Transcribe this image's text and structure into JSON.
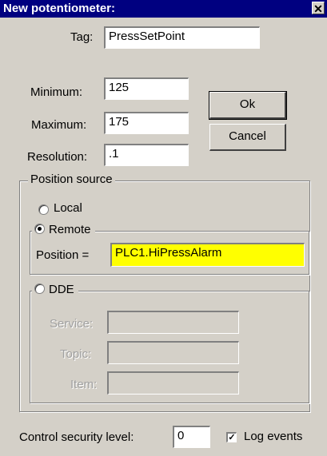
{
  "title": "New potentiometer:",
  "close_label": "✕",
  "fields": {
    "tag": {
      "label": "Tag:",
      "value": "PressSetPoint"
    },
    "minimum": {
      "label": "Minimum:",
      "value": "125"
    },
    "maximum": {
      "label": "Maximum:",
      "value": "175"
    },
    "resolution": {
      "label": "Resolution:",
      "value": ".1"
    }
  },
  "buttons": {
    "ok": "Ok",
    "cancel": "Cancel"
  },
  "position_source": {
    "legend": "Position source",
    "local_label": "Local",
    "remote_label": "Remote",
    "selected": "remote",
    "position_label": "Position =",
    "position_value": "PLC1.HiPressAlarm",
    "dde": {
      "label": "DDE",
      "service_label": "Service:",
      "topic_label": "Topic:",
      "item_label": "Item:",
      "service_value": "",
      "topic_value": "",
      "item_value": ""
    }
  },
  "security": {
    "label": "Control security level:",
    "value": "0"
  },
  "log_events": {
    "label": "Log events",
    "checked": true,
    "check_glyph": "✓"
  },
  "colors": {
    "titlebar": "#000080",
    "position_field": "#ffff00",
    "face": "#d4d0c8"
  }
}
